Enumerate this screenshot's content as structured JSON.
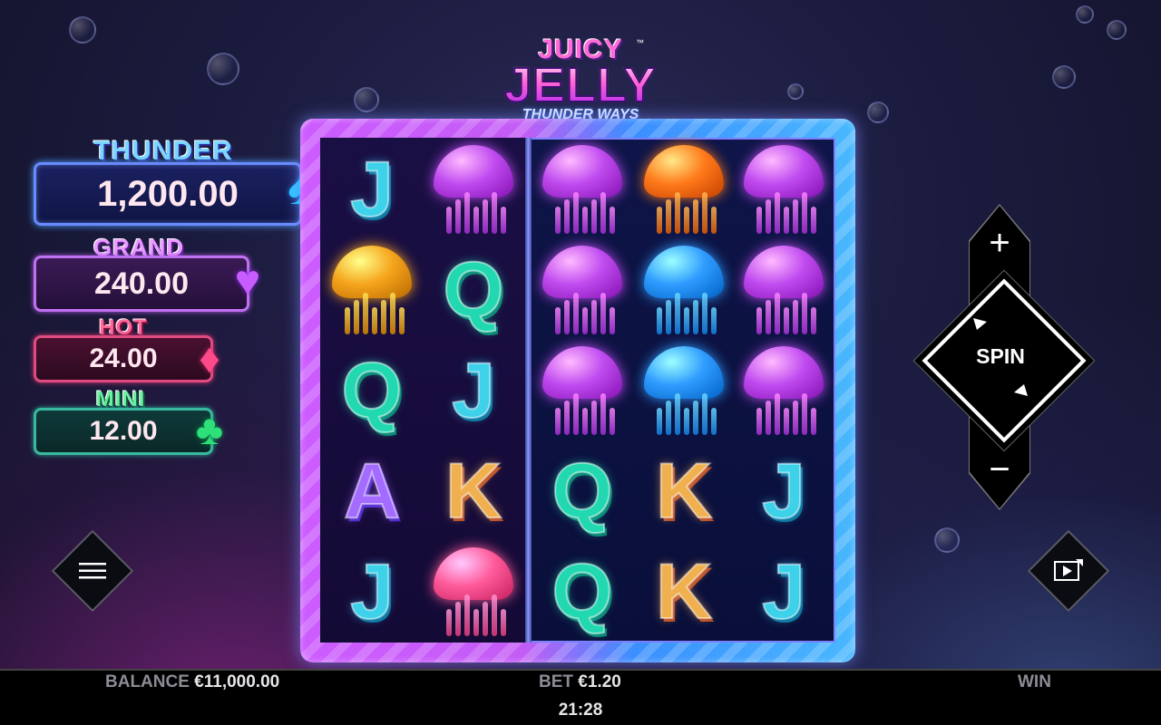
{
  "game": {
    "logo_line1": "JUICY",
    "logo_line2": "JELLY",
    "logo_line3": "THUNDER WAYS",
    "logo_tm": "™"
  },
  "jackpots": [
    {
      "name": "THUNDER",
      "value": "1,200.00",
      "suit": "♠",
      "color": "#2ac8ff"
    },
    {
      "name": "GRAND",
      "value": "240.00",
      "suit": "♥",
      "color": "#c85cff"
    },
    {
      "name": "HOT",
      "value": "24.00",
      "suit": "♦",
      "color": "#ff4a8a"
    },
    {
      "name": "MINI",
      "value": "12.00",
      "suit": "♣",
      "color": "#2ee07a"
    }
  ],
  "reels": {
    "grid": [
      [
        "J",
        "jelly-purple",
        "jelly-purple",
        "jelly-orange",
        "jelly-purple"
      ],
      [
        "jelly-gold",
        "Q",
        "jelly-purple",
        "jelly-blue",
        "jelly-purple"
      ],
      [
        "Q",
        "J",
        "jelly-purple",
        "jelly-blue",
        "jelly-purple"
      ],
      [
        "A",
        "K",
        "Q",
        "K",
        "J"
      ],
      [
        "J",
        "jelly-pink",
        "Q",
        "K",
        "J"
      ]
    ]
  },
  "controls": {
    "plus": "+",
    "minus": "−",
    "spin_label": "SPIN",
    "menu_icon": "hamburger-icon",
    "autoplay_icon": "autoplay-icon"
  },
  "status": {
    "balance_label": "BALANCE",
    "balance_value": "€11,000.00",
    "bet_label": "BET",
    "bet_value": "€1.20",
    "win_label": "WIN",
    "clock": "21:28"
  },
  "colors": {
    "jelly-purple": "#c04cf0",
    "jelly-orange": "#ff7a1a",
    "jelly-gold": "#f5a41c",
    "jelly-blue": "#2f9cff",
    "jelly-pink": "#ff5a9a"
  }
}
